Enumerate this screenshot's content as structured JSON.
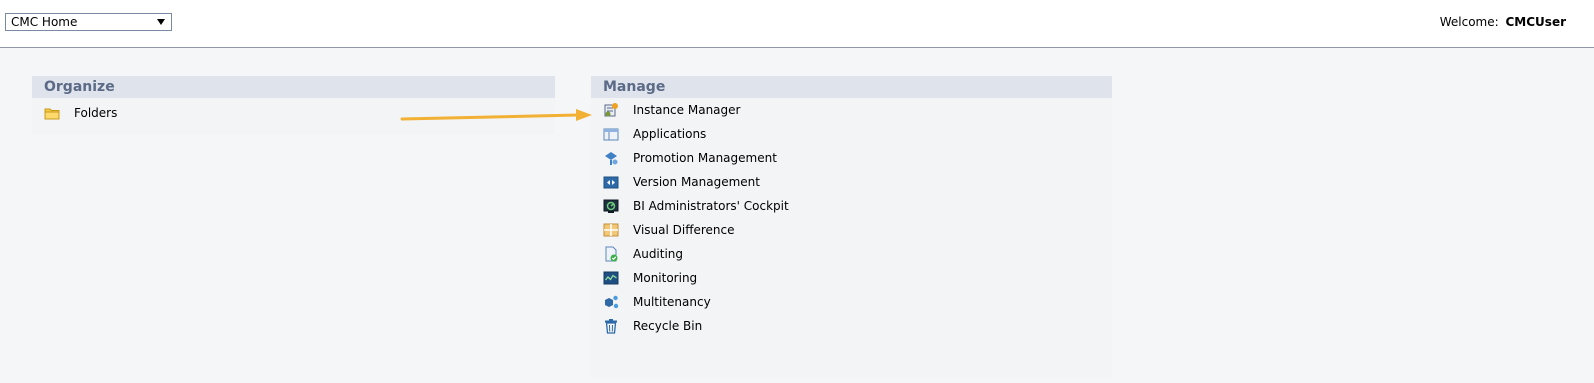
{
  "header": {
    "nav_select_value": "CMC Home",
    "welcome_label": "Welcome:",
    "user_name": "CMCUser"
  },
  "organize": {
    "title": "Organize",
    "items": [
      {
        "label": "Folders",
        "icon": "folder-icon"
      }
    ]
  },
  "manage": {
    "title": "Manage",
    "items": [
      {
        "label": "Instance Manager",
        "icon": "instance-manager-icon"
      },
      {
        "label": "Applications",
        "icon": "applications-icon"
      },
      {
        "label": "Promotion Management",
        "icon": "promotion-management-icon"
      },
      {
        "label": "Version Management",
        "icon": "version-management-icon"
      },
      {
        "label": "BI Administrators' Cockpit",
        "icon": "cockpit-icon"
      },
      {
        "label": "Visual Difference",
        "icon": "visual-difference-icon"
      },
      {
        "label": "Auditing",
        "icon": "auditing-icon"
      },
      {
        "label": "Monitoring",
        "icon": "monitoring-icon"
      },
      {
        "label": "Multitenancy",
        "icon": "multitenancy-icon"
      },
      {
        "label": "Recycle Bin",
        "icon": "recycle-bin-icon"
      }
    ]
  },
  "colors": {
    "panel_header_bg": "#dfe4ec",
    "panel_header_text": "#5b6a87",
    "annotation_arrow": "#f2b134"
  }
}
